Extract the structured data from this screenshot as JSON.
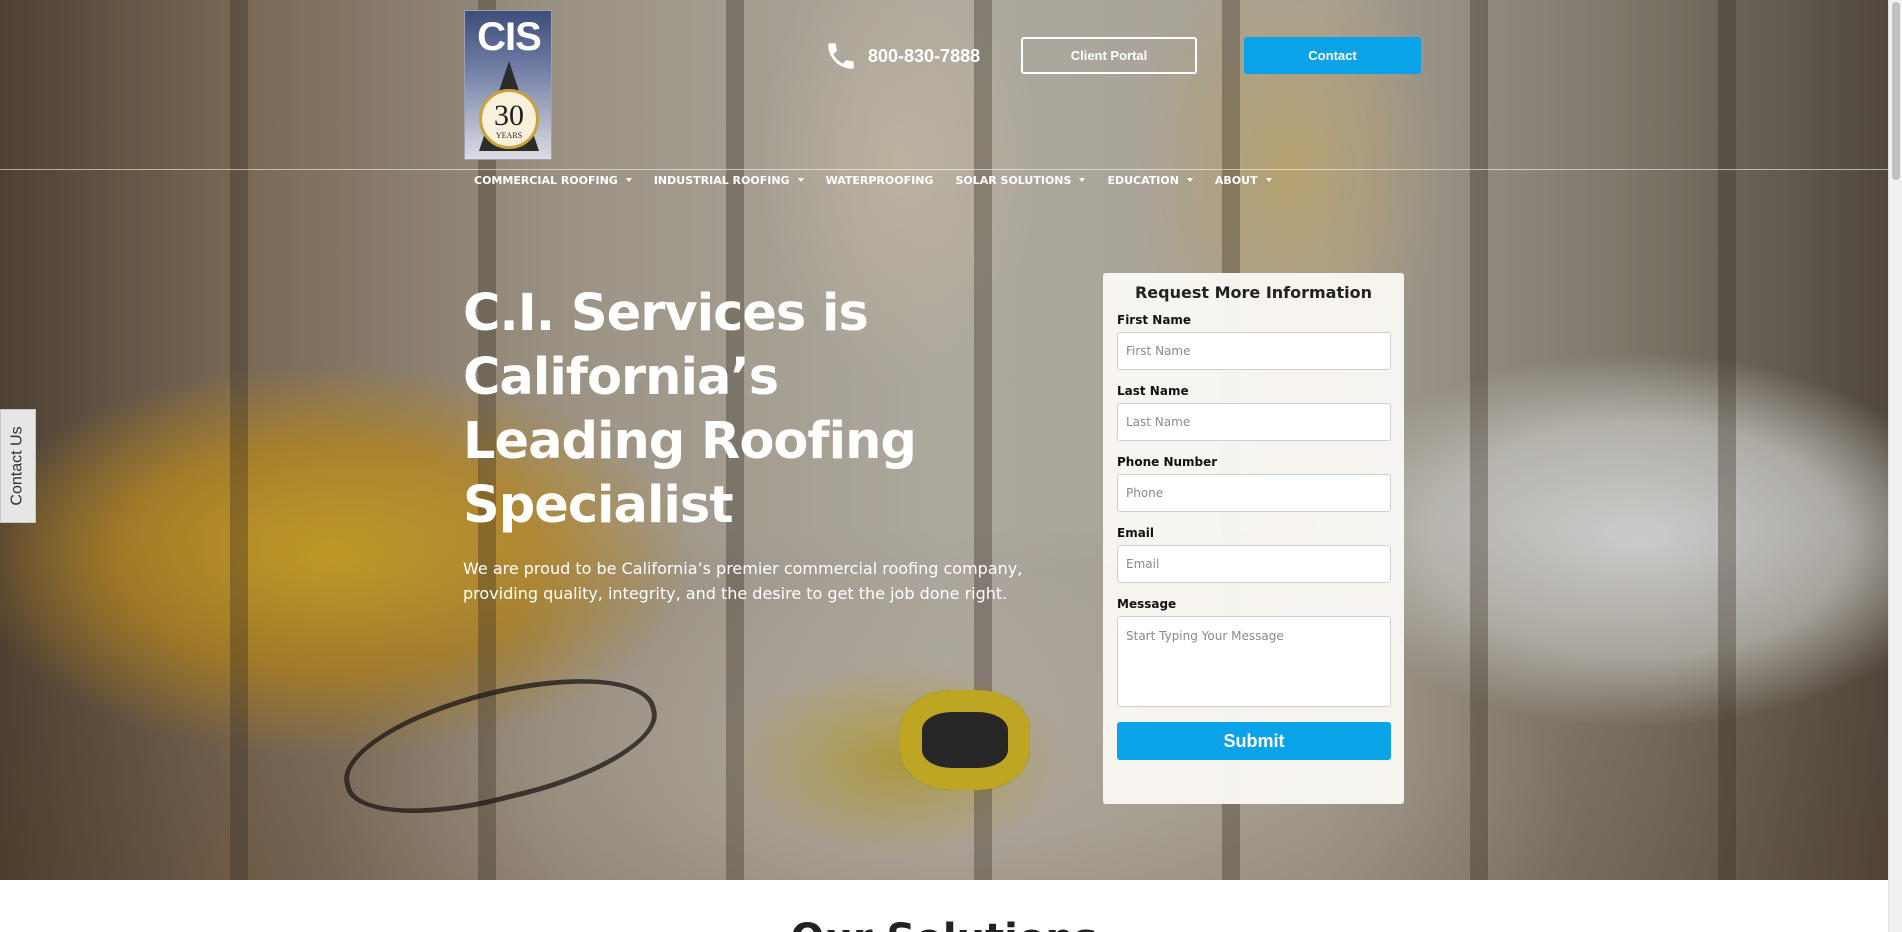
{
  "logo": {
    "brand": "CIS",
    "seal_number": "30",
    "seal_word": "YEARS"
  },
  "header": {
    "phone": "800-830-7888",
    "client_portal_label": "Client Portal",
    "contact_label": "Contact"
  },
  "nav": {
    "items": [
      {
        "label": "COMMERCIAL ROOFING",
        "has_dropdown": true
      },
      {
        "label": "INDUSTRIAL ROOFING",
        "has_dropdown": true
      },
      {
        "label": "WATERPROOFING",
        "has_dropdown": false
      },
      {
        "label": "SOLAR SOLUTIONS",
        "has_dropdown": true
      },
      {
        "label": "EDUCATION",
        "has_dropdown": true
      },
      {
        "label": "ABOUT",
        "has_dropdown": true
      }
    ]
  },
  "hero": {
    "title_lines": [
      "C.I. Services is",
      "California’s",
      "Leading Roofing",
      "Specialist"
    ],
    "subtitle_lines": [
      "We are proud to be California’s premier commercial roofing company,",
      "providing quality, integrity, and the desire to get the job done right."
    ]
  },
  "side_tab": {
    "label": "Contact Us"
  },
  "form": {
    "title": "Request More Information",
    "fields": [
      {
        "label": "First Name",
        "placeholder": "First Name",
        "value": ""
      },
      {
        "label": "Last Name",
        "placeholder": "Last Name",
        "value": ""
      },
      {
        "label": "Phone Number",
        "placeholder": "Phone",
        "value": ""
      },
      {
        "label": "Email",
        "placeholder": "Email",
        "value": ""
      }
    ],
    "message": {
      "label": "Message",
      "placeholder": "Start Typing Your Message",
      "value": ""
    },
    "submit_label": "Submit"
  },
  "section": {
    "title": "Our Solutions"
  },
  "colors": {
    "accent": "#0aa3e8",
    "text_light": "#ffffff",
    "form_bg": "#faf8f4"
  },
  "icons": {
    "phone": "phone-icon",
    "caret": "caret-down-icon"
  }
}
